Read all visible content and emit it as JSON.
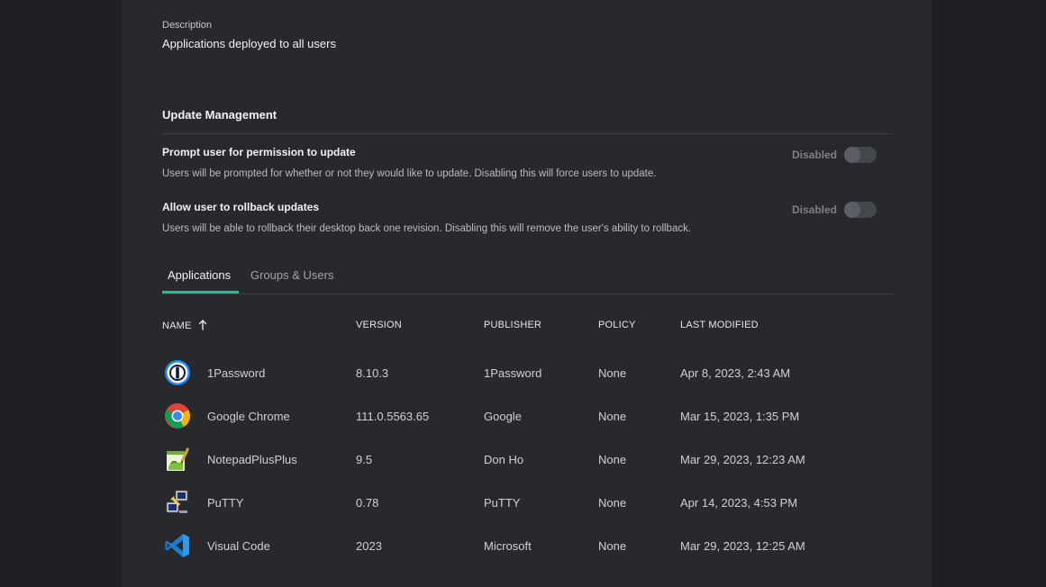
{
  "description": {
    "label": "Description",
    "value": "Applications deployed to all users"
  },
  "update_management": {
    "title": "Update Management",
    "settings": [
      {
        "title": "Prompt user for permission to update",
        "description": "Users will be prompted for whether or not they would like to update. Disabling this will force users to update.",
        "state_label": "Disabled",
        "enabled": false
      },
      {
        "title": "Allow user to rollback updates",
        "description": "Users will be able to rollback their desktop back one revision. Disabling this will remove the user's ability to rollback.",
        "state_label": "Disabled",
        "enabled": false
      }
    ]
  },
  "tabs": [
    {
      "label": "Applications",
      "active": true
    },
    {
      "label": "Groups & Users",
      "active": false
    }
  ],
  "table": {
    "columns": [
      "NAME",
      "VERSION",
      "PUBLISHER",
      "POLICY",
      "LAST MODIFIED"
    ],
    "sort_column": "NAME",
    "sort_direction": "ascending",
    "rows": [
      {
        "icon": "1password-icon",
        "name": "1Password",
        "version": "8.10.3",
        "publisher": "1Password",
        "policy": "None",
        "modified": "Apr 8, 2023, 2:43 AM"
      },
      {
        "icon": "chrome-icon",
        "name": "Google Chrome",
        "version": "111.0.5563.65",
        "publisher": "Google",
        "policy": "None",
        "modified": "Mar 15, 2023, 1:35 PM"
      },
      {
        "icon": "notepadplusplus-icon",
        "name": "NotepadPlusPlus",
        "version": "9.5",
        "publisher": "Don Ho",
        "policy": "None",
        "modified": "Mar 29, 2023, 12:23 AM"
      },
      {
        "icon": "putty-icon",
        "name": "PuTTY",
        "version": "0.78",
        "publisher": "PuTTY",
        "policy": "None",
        "modified": "Apr 14, 2023, 4:53 PM"
      },
      {
        "icon": "vscode-icon",
        "name": "Visual Code",
        "version": "2023",
        "publisher": "Microsoft",
        "policy": "None",
        "modified": "Mar 29, 2023, 12:25 AM"
      }
    ]
  },
  "colors": {
    "background": "#1e1f22",
    "panel": "#27292d",
    "accent": "#1fbf97"
  }
}
